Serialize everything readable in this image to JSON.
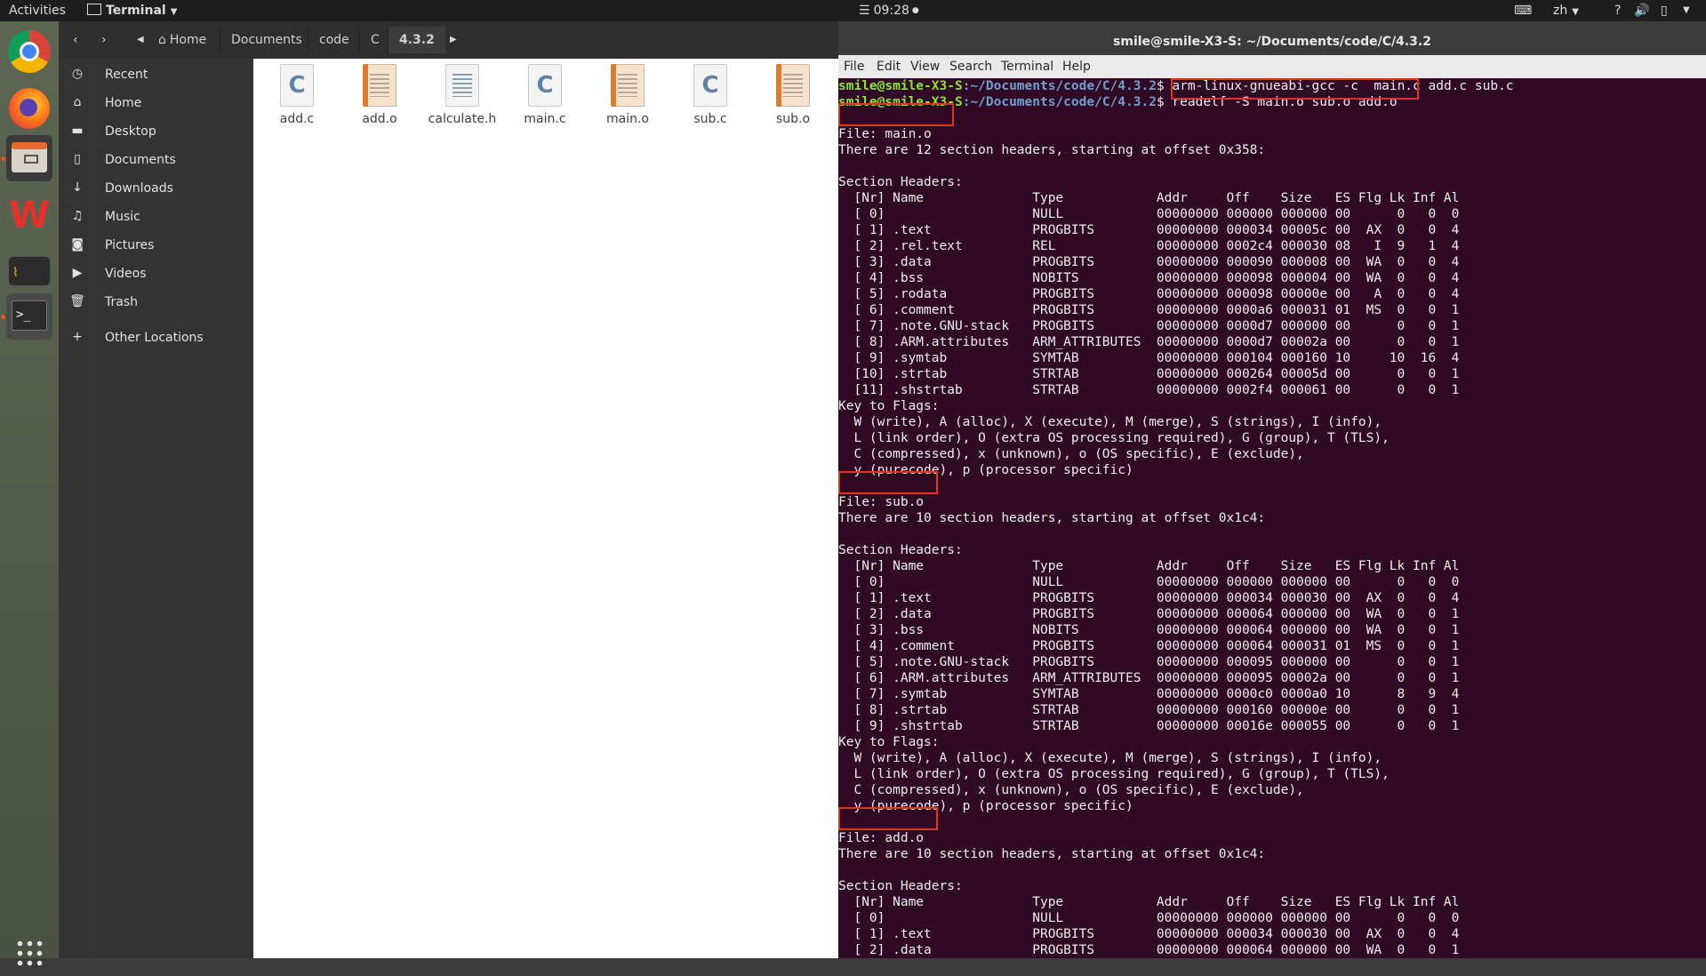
{
  "topbar": {
    "activities": "Activities",
    "app_menu": "Terminal",
    "clock": "09:28",
    "input_method": "zh"
  },
  "files": {
    "nav": {
      "home_crumb": "Home",
      "crumbs": [
        "Documents",
        "code",
        "C",
        "4.3.2"
      ]
    },
    "sidebar": [
      {
        "label": "Recent",
        "icon": "clock-icon"
      },
      {
        "label": "Home",
        "icon": "home-icon"
      },
      {
        "label": "Desktop",
        "icon": "folder-icon"
      },
      {
        "label": "Documents",
        "icon": "document-icon"
      },
      {
        "label": "Downloads",
        "icon": "download-icon"
      },
      {
        "label": "Music",
        "icon": "music-icon"
      },
      {
        "label": "Pictures",
        "icon": "camera-icon"
      },
      {
        "label": "Videos",
        "icon": "video-icon"
      },
      {
        "label": "Trash",
        "icon": "trash-icon"
      },
      {
        "label": "Other Locations",
        "icon": "plus-icon"
      }
    ],
    "items": [
      {
        "name": "add.c",
        "kind": "c"
      },
      {
        "name": "add.o",
        "kind": "o"
      },
      {
        "name": "calculate.h",
        "kind": "h"
      },
      {
        "name": "main.c",
        "kind": "c"
      },
      {
        "name": "main.o",
        "kind": "o"
      },
      {
        "name": "sub.c",
        "kind": "c"
      },
      {
        "name": "sub.o",
        "kind": "o"
      }
    ]
  },
  "terminal": {
    "title": "smile@smile-X3-S: ~/Documents/code/C/4.3.2",
    "menu": [
      "File",
      "Edit",
      "View",
      "Search",
      "Terminal",
      "Help"
    ],
    "prompt_user": "smile@smile-X3-S",
    "prompt_path": ":~/Documents/code/C/4.3.2",
    "prompt_sym": "$ ",
    "commands": [
      "arm-linux-gnueabi-gcc -c  main.c add.c sub.c",
      "readelf -S main.o sub.o add.o"
    ],
    "output": [
      "",
      "File: main.o",
      "There are 12 section headers, starting at offset 0x358:",
      "",
      "Section Headers:",
      "  [Nr] Name              Type            Addr     Off    Size   ES Flg Lk Inf Al",
      "  [ 0]                   NULL            00000000 000000 000000 00      0   0  0",
      "  [ 1] .text             PROGBITS        00000000 000034 00005c 00  AX  0   0  4",
      "  [ 2] .rel.text         REL             00000000 0002c4 000030 08   I  9   1  4",
      "  [ 3] .data             PROGBITS        00000000 000090 000008 00  WA  0   0  4",
      "  [ 4] .bss              NOBITS          00000000 000098 000004 00  WA  0   0  4",
      "  [ 5] .rodata           PROGBITS        00000000 000098 00000e 00   A  0   0  4",
      "  [ 6] .comment          PROGBITS        00000000 0000a6 000031 01  MS  0   0  1",
      "  [ 7] .note.GNU-stack   PROGBITS        00000000 0000d7 000000 00      0   0  1",
      "  [ 8] .ARM.attributes   ARM_ATTRIBUTES  00000000 0000d7 00002a 00      0   0  1",
      "  [ 9] .symtab           SYMTAB          00000000 000104 000160 10     10  16  4",
      "  [10] .strtab           STRTAB          00000000 000264 00005d 00      0   0  1",
      "  [11] .shstrtab         STRTAB          00000000 0002f4 000061 00      0   0  1",
      "Key to Flags:",
      "  W (write), A (alloc), X (execute), M (merge), S (strings), I (info),",
      "  L (link order), O (extra OS processing required), G (group), T (TLS),",
      "  C (compressed), x (unknown), o (OS specific), E (exclude),",
      "  y (purecode), p (processor specific)",
      "",
      "File: sub.o",
      "There are 10 section headers, starting at offset 0x1c4:",
      "",
      "Section Headers:",
      "  [Nr] Name              Type            Addr     Off    Size   ES Flg Lk Inf Al",
      "  [ 0]                   NULL            00000000 000000 000000 00      0   0  0",
      "  [ 1] .text             PROGBITS        00000000 000034 000030 00  AX  0   0  4",
      "  [ 2] .data             PROGBITS        00000000 000064 000000 00  WA  0   0  1",
      "  [ 3] .bss              NOBITS          00000000 000064 000000 00  WA  0   0  1",
      "  [ 4] .comment          PROGBITS        00000000 000064 000031 01  MS  0   0  1",
      "  [ 5] .note.GNU-stack   PROGBITS        00000000 000095 000000 00      0   0  1",
      "  [ 6] .ARM.attributes   ARM_ATTRIBUTES  00000000 000095 00002a 00      0   0  1",
      "  [ 7] .symtab           SYMTAB          00000000 0000c0 0000a0 10      8   9  4",
      "  [ 8] .strtab           STRTAB          00000000 000160 00000e 00      0   0  1",
      "  [ 9] .shstrtab         STRTAB          00000000 00016e 000055 00      0   0  1",
      "Key to Flags:",
      "  W (write), A (alloc), X (execute), M (merge), S (strings), I (info),",
      "  L (link order), O (extra OS processing required), G (group), T (TLS),",
      "  C (compressed), x (unknown), o (OS specific), E (exclude),",
      "  y (purecode), p (processor specific)",
      "",
      "File: add.o",
      "There are 10 section headers, starting at offset 0x1c4:",
      "",
      "Section Headers:",
      "  [Nr] Name              Type            Addr     Off    Size   ES Flg Lk Inf Al",
      "  [ 0]                   NULL            00000000 000000 000000 00      0   0  0",
      "  [ 1] .text             PROGBITS        00000000 000034 000030 00  AX  0   0  4",
      "  [ 2] .data             PROGBITS        00000000 000064 000000 00  WA  0   0  1"
    ],
    "colors": {
      "background": "#300a24",
      "prompt_user": "#8ae234",
      "prompt_path": "#729fcf",
      "highlight_box": "#e0341a"
    }
  }
}
